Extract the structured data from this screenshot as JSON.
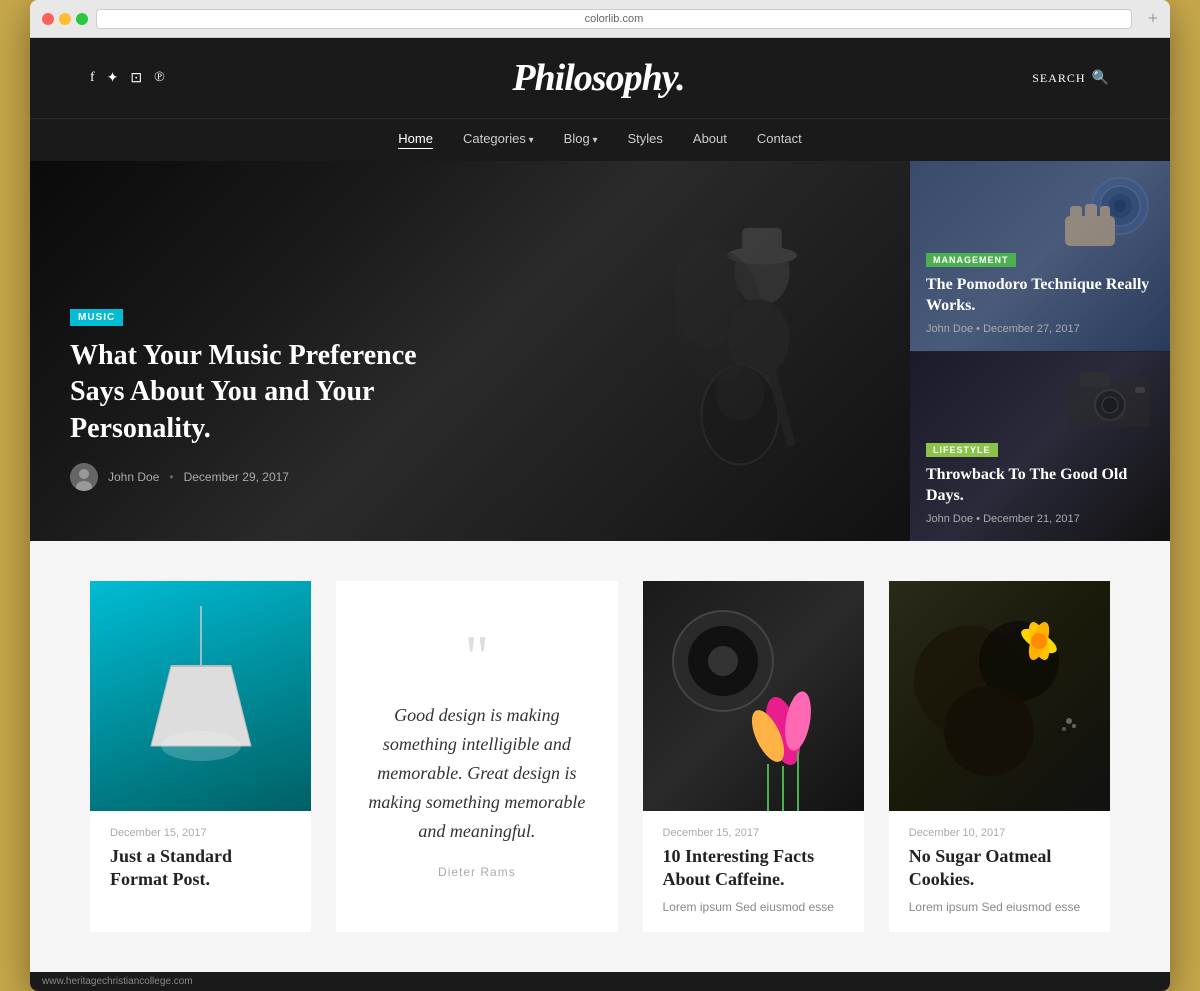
{
  "browser": {
    "url": "colorlib.com",
    "new_tab_label": "+"
  },
  "header": {
    "title": "Philosophy.",
    "search_label": "SEARCH",
    "social_icons": [
      "f",
      "𝕏",
      "♡",
      "P"
    ]
  },
  "nav": {
    "items": [
      {
        "label": "Home",
        "active": true
      },
      {
        "label": "Categories",
        "has_arrow": true
      },
      {
        "label": "Blog",
        "has_arrow": true
      },
      {
        "label": "Styles"
      },
      {
        "label": "About"
      },
      {
        "label": "Contact"
      }
    ]
  },
  "hero": {
    "badge": "MUSIC",
    "title": "What Your Music Preference Says About You and Your Personality.",
    "author": "John Doe",
    "date": "December 29, 2017"
  },
  "side_cards": [
    {
      "badge": "MANAGEMENT",
      "title": "The Pomodoro Technique Really Works.",
      "author": "John Doe",
      "date": "December 27, 2017"
    },
    {
      "badge": "LIFESTYLE",
      "title": "Throwback To The Good Old Days.",
      "author": "John Doe",
      "date": "December 21, 2017"
    }
  ],
  "blog_cards": [
    {
      "type": "image",
      "date": "December 15, 2017",
      "title": "Just a Standard Format Post.",
      "excerpt": ""
    },
    {
      "type": "quote",
      "quote_text": "Good design is making something intelligible and memorable. Great design is making something memorable and meaningful.",
      "quote_author": "Dieter Rams"
    },
    {
      "type": "image",
      "date": "December 15, 2017",
      "title": "10 Interesting Facts About Caffeine.",
      "excerpt": "Lorem ipsum Sed eiusmod esse"
    },
    {
      "type": "image",
      "date": "December 10, 2017",
      "title": "No Sugar Oatmeal Cookies.",
      "excerpt": "Lorem ipsum Sed eiusmod esse"
    }
  ],
  "footer": {
    "url": "www.heritagechristiancollege.com"
  }
}
